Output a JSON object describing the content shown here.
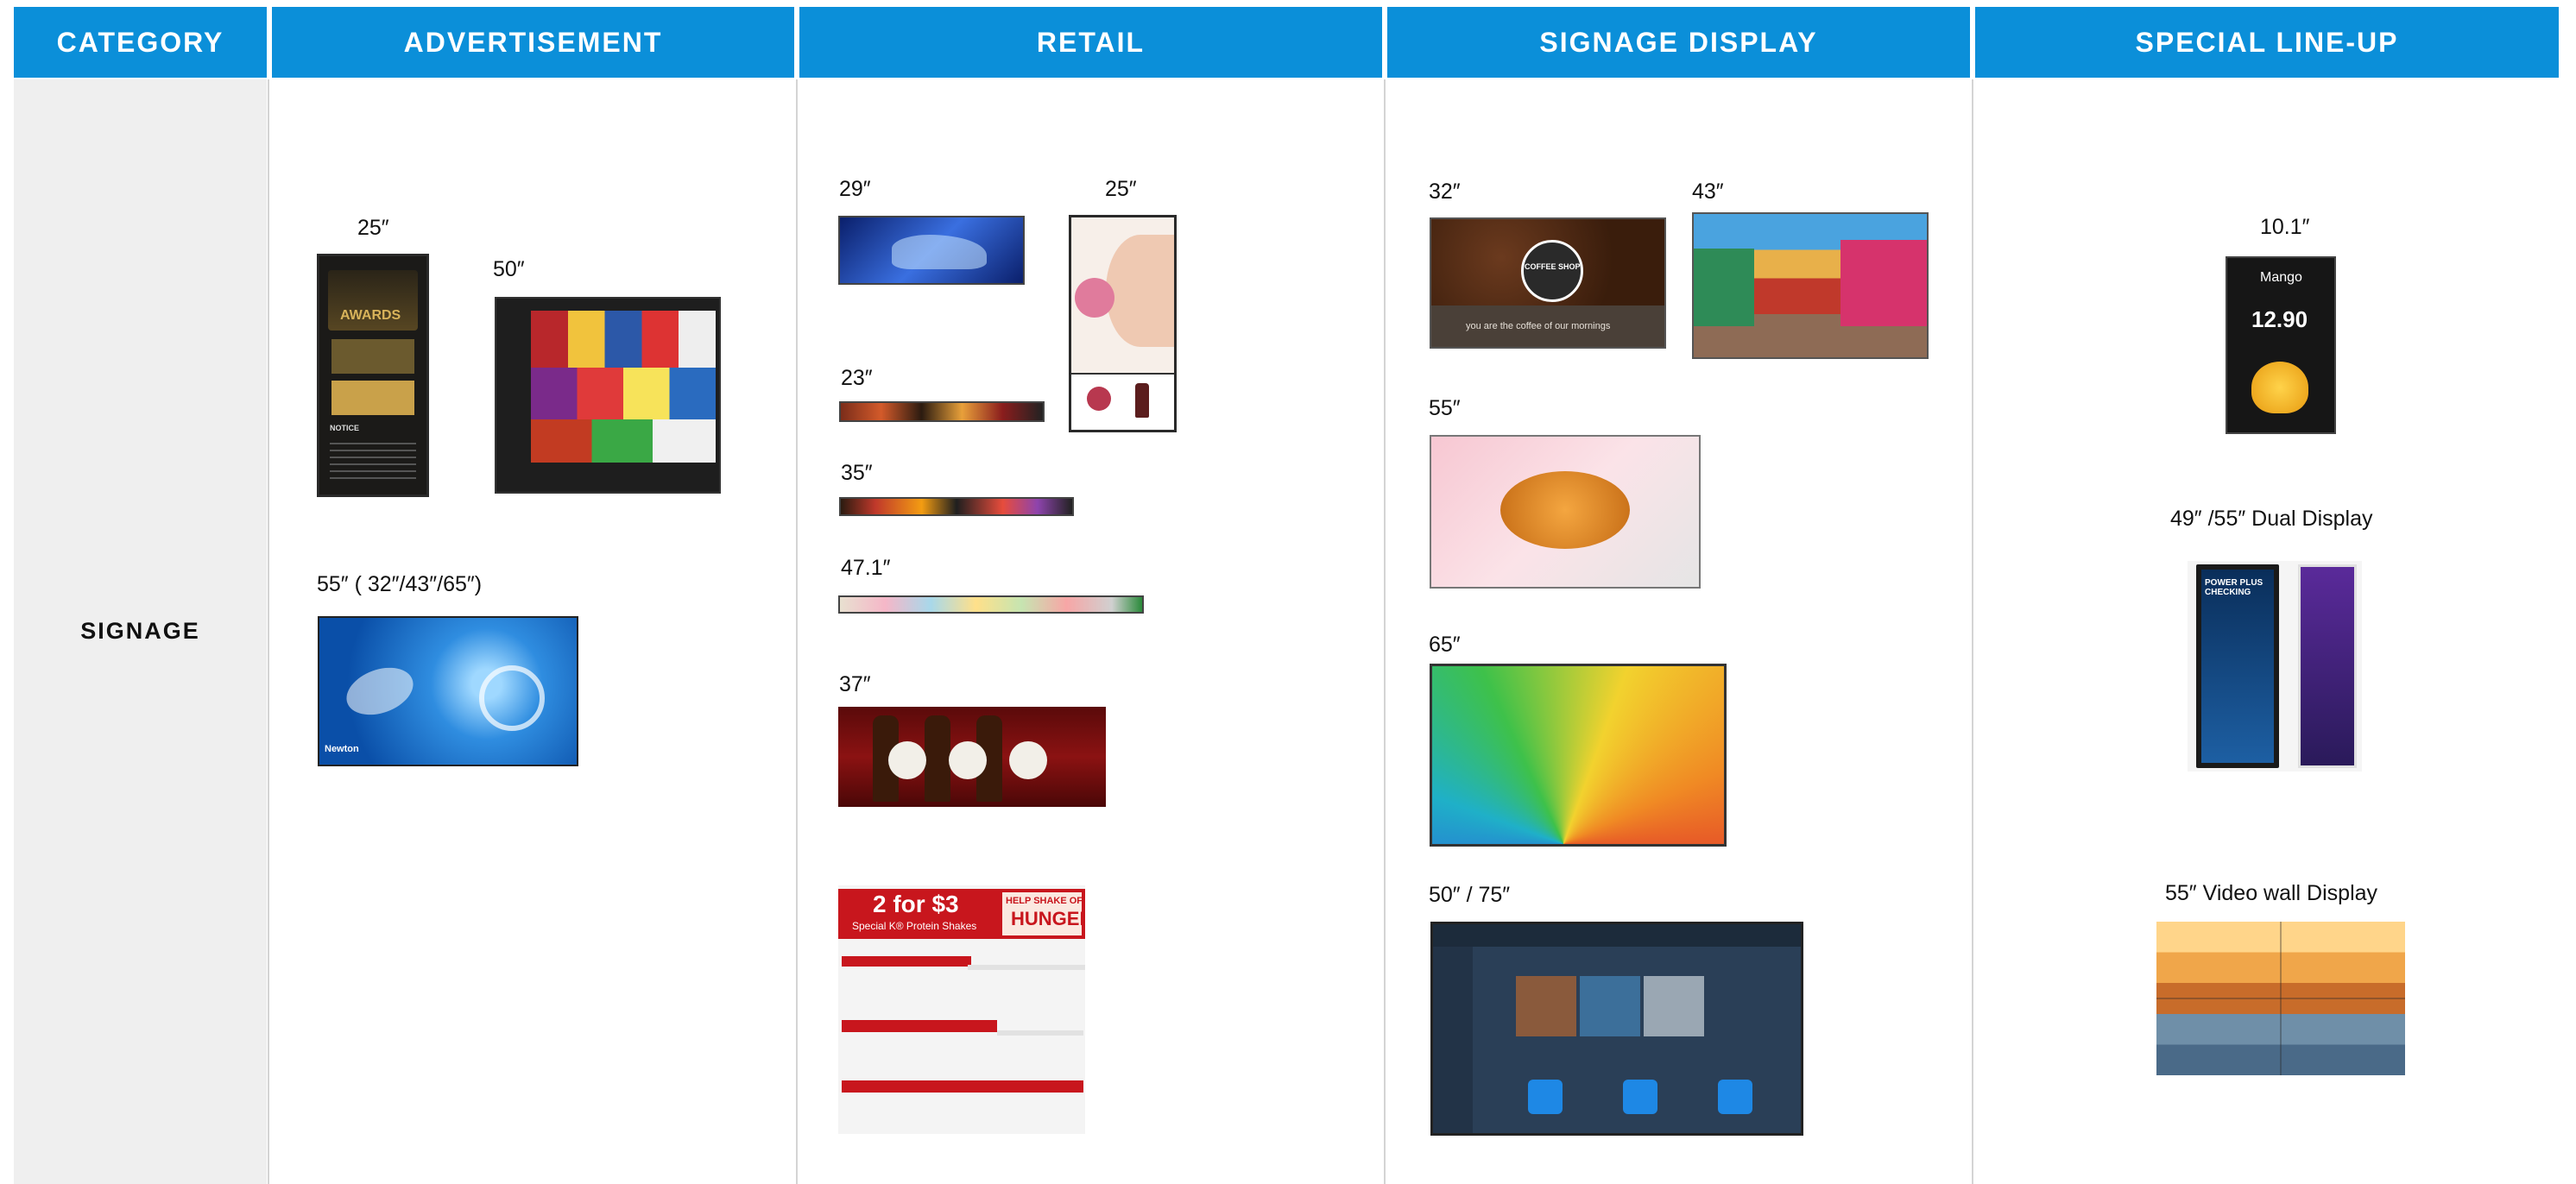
{
  "headers": {
    "category": "CATEGORY",
    "advertisement": "ADVERTISEMENT",
    "retail": "RETAIL",
    "signage_display": "SIGNAGE DISPLAY",
    "special_lineup": "SPECIAL LINE-UP"
  },
  "row_label": "SIGNAGE",
  "colors": {
    "header_blue": "#0b8fd9",
    "category_bg": "#efefef",
    "text": "#111111"
  },
  "advertisement": {
    "a25": "25″",
    "a50": "50″",
    "a55": "55″ ( 32″/43″/65″)",
    "awards_title": "AWARDS",
    "notice": "NOTICE",
    "screen_brand": "Newton"
  },
  "retail": {
    "r29": "29″",
    "r25": "25″",
    "r23": "23″",
    "r35": "35″",
    "r47": "47.1″",
    "r37": "37″",
    "promo_main": "2 for $3",
    "promo_sub": "Special K® Protein Shakes",
    "promo_help": "HELP SHAKE OFF",
    "promo_hunger": "HUNGER"
  },
  "signage_display": {
    "s32": "32″",
    "s43": "43″",
    "s55": "55″",
    "s65": "65″",
    "s5075": "50″ / 75″",
    "coffee_brand": "COFFEE SHOP",
    "coffee_tag": "you are the coffee of our mornings"
  },
  "special": {
    "s101": "10.1″",
    "dual": "49″ /55″ Dual Display",
    "videowall": "55″ Video wall Display",
    "mango": "Mango",
    "price": "12.90",
    "power_plus": "POWER PLUS CHECKING"
  }
}
